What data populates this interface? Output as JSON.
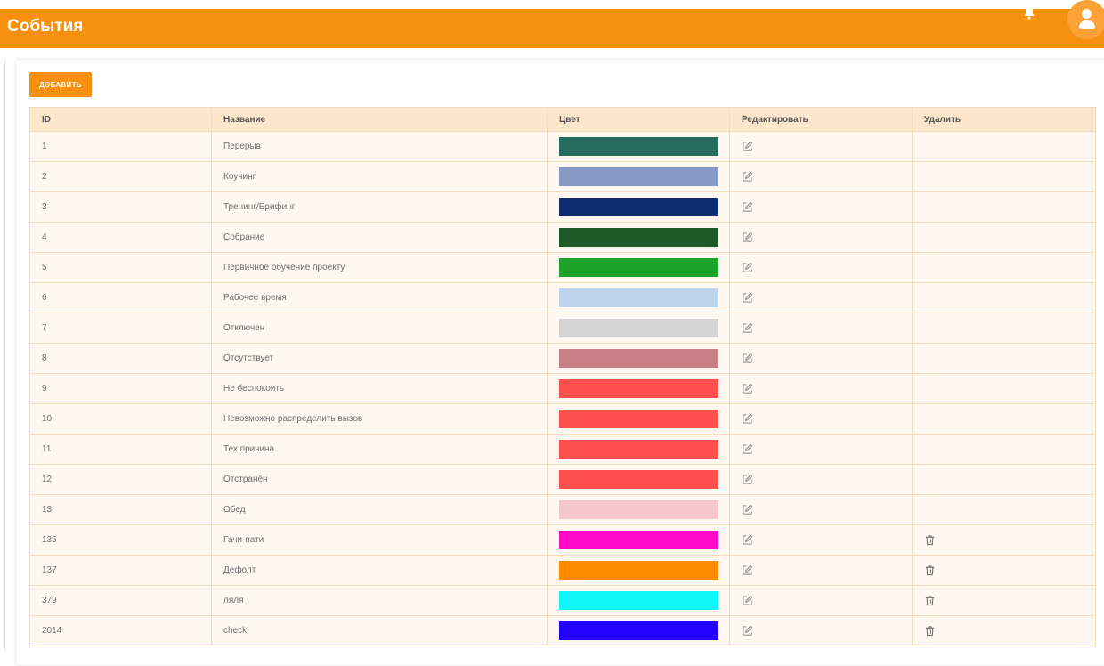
{
  "header": {
    "title": "События",
    "accent_color": "#f7900f"
  },
  "toolbar": {
    "add_label": "ДОБАВИТЬ"
  },
  "table": {
    "columns": [
      "ID",
      "Название",
      "Цвет",
      "Редактировать",
      "Удалить"
    ],
    "rows": [
      {
        "id": "1",
        "name": "Перерыв",
        "color": "#276b5e",
        "deletable": false
      },
      {
        "id": "2",
        "name": "Коучинг",
        "color": "#8799c5",
        "deletable": false
      },
      {
        "id": "3",
        "name": "Тренинг/Брифинг",
        "color": "#0f2d73",
        "deletable": false
      },
      {
        "id": "4",
        "name": "Собрание",
        "color": "#1d5a28",
        "deletable": false
      },
      {
        "id": "5",
        "name": "Первичное обучение проекту",
        "color": "#1ea32a",
        "deletable": false
      },
      {
        "id": "6",
        "name": "Рабочее время",
        "color": "#bed5ee",
        "deletable": false
      },
      {
        "id": "7",
        "name": "Отключен",
        "color": "#d4d4d4",
        "deletable": false
      },
      {
        "id": "8",
        "name": "Отсутствует",
        "color": "#c97f86",
        "deletable": false
      },
      {
        "id": "9",
        "name": "Не беспокоить",
        "color": "#ff5050",
        "deletable": false
      },
      {
        "id": "10",
        "name": "Невозможно распределить вызов",
        "color": "#ff5050",
        "deletable": false
      },
      {
        "id": "11",
        "name": "Тех.причина",
        "color": "#ff5050",
        "deletable": false
      },
      {
        "id": "12",
        "name": "Отстранён",
        "color": "#ff5050",
        "deletable": false
      },
      {
        "id": "13",
        "name": "Обед",
        "color": "#f5c6cc",
        "deletable": false
      },
      {
        "id": "135",
        "name": "Гачи-пати",
        "color": "#ff0ac8",
        "deletable": true
      },
      {
        "id": "137",
        "name": "Дефолт",
        "color": "#ff8c00",
        "deletable": true
      },
      {
        "id": "379",
        "name": "ляля",
        "color": "#0ff5fa",
        "deletable": true
      },
      {
        "id": "2014",
        "name": "check",
        "color": "#2400ff",
        "deletable": true
      }
    ]
  },
  "icons": {
    "edit": "edit-icon",
    "delete": "trash-icon",
    "notifications": "bell-icon",
    "user": "user-avatar-icon"
  }
}
